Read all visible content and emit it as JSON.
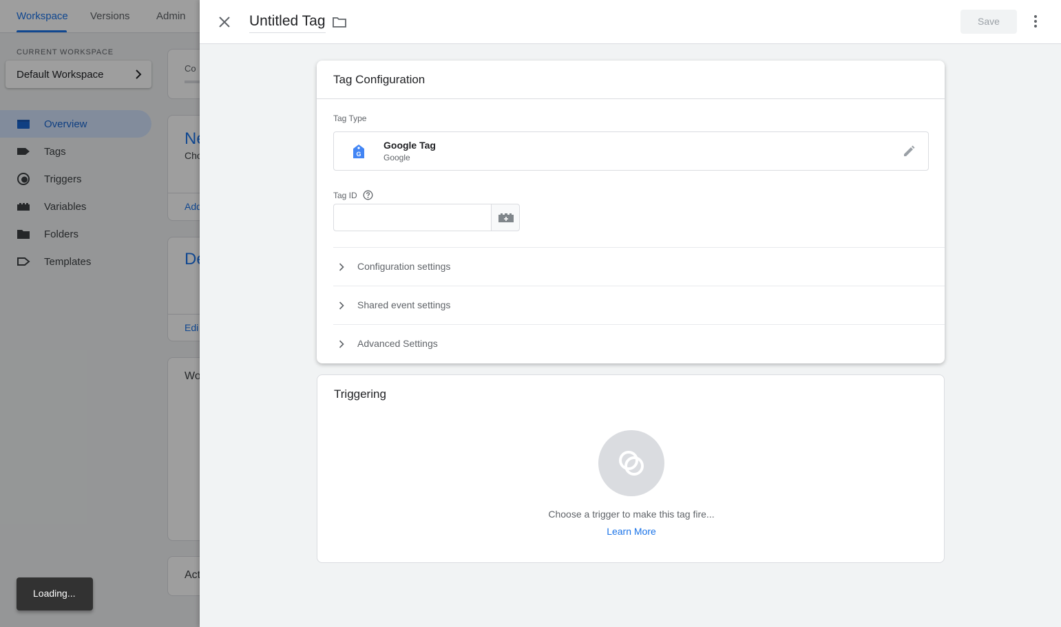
{
  "workspace_nav": {
    "tabs": [
      {
        "label": "Workspace",
        "active": true
      },
      {
        "label": "Versions",
        "active": false
      },
      {
        "label": "Admin",
        "active": false
      }
    ],
    "current_workspace_label": "CURRENT WORKSPACE",
    "current_workspace_value": "Default Workspace",
    "sidebar": [
      {
        "label": "Overview",
        "icon": "overview-icon",
        "active": true
      },
      {
        "label": "Tags",
        "icon": "tag-icon",
        "active": false
      },
      {
        "label": "Triggers",
        "icon": "trigger-icon",
        "active": false
      },
      {
        "label": "Variables",
        "icon": "variable-icon",
        "active": false
      },
      {
        "label": "Folders",
        "icon": "folder-icon",
        "active": false
      },
      {
        "label": "Templates",
        "icon": "template-icon",
        "active": false
      }
    ]
  },
  "background_cards": {
    "card1_text": "Co",
    "card2_title": "Ne",
    "card2_sub": "Cho",
    "card2_link": "Add",
    "card3_title": "De",
    "card3_link": "Edi",
    "card4_title": "Wo",
    "card5_title": "Act"
  },
  "toast": "Loading...",
  "sheet": {
    "title": "Untitled Tag",
    "save_label": "Save",
    "tag_configuration": {
      "title": "Tag Configuration",
      "tag_type_label": "Tag Type",
      "tag_type_name": "Google Tag",
      "tag_type_vendor": "Google",
      "tag_id_label": "Tag ID",
      "tag_id_value": "",
      "sections": [
        {
          "label": "Configuration settings"
        },
        {
          "label": "Shared event settings"
        },
        {
          "label": "Advanced Settings"
        }
      ]
    },
    "triggering": {
      "title": "Triggering",
      "hint": "Choose a trigger to make this tag fire...",
      "learn_more": "Learn More"
    }
  },
  "colors": {
    "accent": "#1a73e8",
    "nav_active_bg": "#d2e3fc",
    "toast_bg": "#323232"
  }
}
